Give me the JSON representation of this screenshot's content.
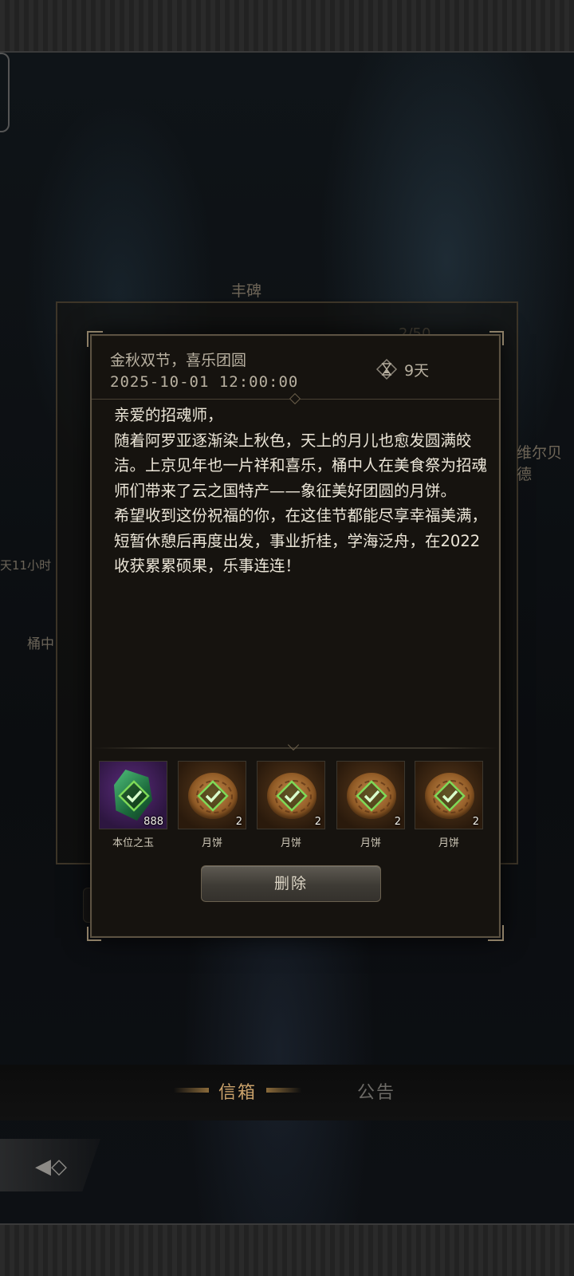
{
  "background": {
    "panel_title": "丰碑",
    "count_text": "2/50",
    "side_left_1": "天11小时",
    "side_left_2": "桶中",
    "side_right": "维尔贝德"
  },
  "tabs": [
    {
      "label": "信箱",
      "active": true
    },
    {
      "label": "公告",
      "active": false
    }
  ],
  "mail": {
    "title": "金秋双节，喜乐团圆",
    "datetime": "2025-10-01  12:00:00",
    "expire": "9天",
    "body": "亲爱的招魂师，\n随着阿罗亚逐渐染上秋色，天上的月儿也愈发圆满皎洁。上京见年也一片祥和喜乐，桶中人在美食祭为招魂师们带来了云之国特产——象征美好团圆的月饼。\n希望收到这份祝福的你，在这佳节都能尽享幸福美满，短暂休憩后再度出发，事业折桂，学海泛舟，在2022收获累累硕果，乐事连连！",
    "attachments": [
      {
        "name": "本位之玉",
        "count": "888",
        "icon": "green-gem-icon",
        "rarity_color": "#5a2b7a"
      },
      {
        "name": "月饼",
        "count": "2",
        "icon": "mooncake-icon",
        "rarity_color": "#5a3a1c"
      },
      {
        "name": "月饼",
        "count": "2",
        "icon": "mooncake-icon",
        "rarity_color": "#5a3a1c"
      },
      {
        "name": "月饼",
        "count": "2",
        "icon": "mooncake-icon",
        "rarity_color": "#5a3a1c"
      },
      {
        "name": "月饼",
        "count": "2",
        "icon": "mooncake-icon",
        "rarity_color": "#5a3a1c"
      }
    ],
    "delete_label": "删除"
  },
  "colors": {
    "accent_gold": "#c9a16a",
    "claimed_check": "#7ed957"
  }
}
